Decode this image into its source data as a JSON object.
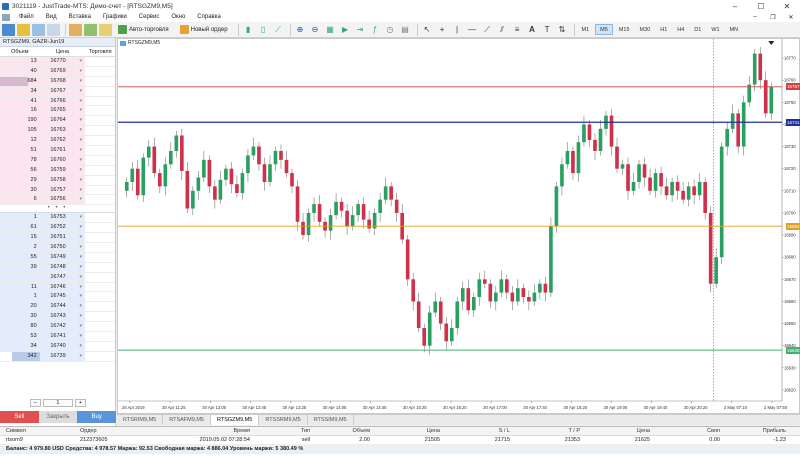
{
  "window": {
    "title": "3021119 - JustTrade-MTS: Демо-счет - [RTSGZM9,M5]",
    "minimize": "–",
    "maximize": "☐",
    "close": "✕"
  },
  "menu": {
    "items": [
      "Файл",
      "Вид",
      "Вставка",
      "Графики",
      "Сервис",
      "Окно",
      "Справка"
    ],
    "right": [
      "–",
      "❐",
      "✕"
    ]
  },
  "toolbar": {
    "autotrade_label": "Авто-торговля",
    "new_order_label": "Новый ордер",
    "timeframes": [
      "M1",
      "M5",
      "M15",
      "M30",
      "H1",
      "H4",
      "D1",
      "W1",
      "MN"
    ],
    "active_timeframe": "M5"
  },
  "dom": {
    "title": "RTSGZM9, GAZR-Jun19",
    "headers": {
      "volume": "Объем",
      "price": "Цена",
      "trade": "Торговля"
    },
    "asks": [
      {
        "volume": "13",
        "price": "16770"
      },
      {
        "volume": "40",
        "price": "16769"
      },
      {
        "volume": "684",
        "price": "16768"
      },
      {
        "volume": "34",
        "price": "16767"
      },
      {
        "volume": "41",
        "price": "16766"
      },
      {
        "volume": "16",
        "price": "16765"
      },
      {
        "volume": "190",
        "price": "16764"
      },
      {
        "volume": "105",
        "price": "16763"
      },
      {
        "volume": "12",
        "price": "16762"
      },
      {
        "volume": "51",
        "price": "16761"
      },
      {
        "volume": "78",
        "price": "16760"
      },
      {
        "volume": "56",
        "price": "16759"
      },
      {
        "volume": "29",
        "price": "16758"
      },
      {
        "volume": "30",
        "price": "16757"
      },
      {
        "volume": "6",
        "price": "16756"
      }
    ],
    "separator": "• • •",
    "bids": [
      {
        "volume": "1",
        "price": "16753"
      },
      {
        "volume": "61",
        "price": "16752"
      },
      {
        "volume": "15",
        "price": "16751"
      },
      {
        "volume": "2",
        "price": "16750"
      },
      {
        "volume": "55",
        "price": "16749"
      },
      {
        "volume": "39",
        "price": "16748"
      },
      {
        "volume": "",
        "price": "16747"
      },
      {
        "volume": "11",
        "price": "16746"
      },
      {
        "volume": "1",
        "price": "16745"
      },
      {
        "volume": "20",
        "price": "16744"
      },
      {
        "volume": "30",
        "price": "16743"
      },
      {
        "volume": "80",
        "price": "16742"
      },
      {
        "volume": "53",
        "price": "16741"
      },
      {
        "volume": "34",
        "price": "16740"
      },
      {
        "volume": "342",
        "price": "16739"
      }
    ],
    "qty_minus": "–",
    "qty_value": "1",
    "qty_plus": "+",
    "sell_label": "Sell",
    "close_label": "Закрыть",
    "buy_label": "Buy"
  },
  "chart": {
    "title": "RTSGZM9,M5",
    "x_labels": [
      "26 Apr 2019",
      "30 Apr 11:25",
      "30 Apr 12:05",
      "30 Apr 12:45",
      "30 Apr 13:25",
      "30 Apr 14:05",
      "30 Apr 14:45",
      "30 Apr 15:25",
      "30 Apr 16:20",
      "30 Apr 17:00",
      "30 Apr 17:40",
      "30 Apr 18:20",
      "30 Apr 19:00",
      "30 Apr 19:40",
      "30 Apr 20:20",
      "2 May 07:10",
      "2 May 07:50"
    ],
    "y_labels": [
      "16770",
      "16760",
      "16750",
      "16740",
      "16730",
      "16720",
      "16710",
      "16700",
      "16690",
      "16680",
      "16670",
      "16660",
      "16650",
      "16640",
      "16630",
      "16620"
    ],
    "line_labels": {
      "red": "16757",
      "blue": "16741",
      "orange": "16694",
      "green": "16638"
    }
  },
  "chart_data": {
    "type": "candlestick",
    "hlines": [
      {
        "name": "red",
        "value": 16757,
        "color": "#d04040"
      },
      {
        "name": "blue",
        "value": 16741,
        "color": "#2030a0"
      },
      {
        "name": "orange",
        "value": 16694,
        "color": "#e0a020"
      },
      {
        "name": "green",
        "value": 16638,
        "color": "#40b070"
      }
    ],
    "vline_after_index": 106,
    "closes": [
      16714,
      16720,
      16708,
      16725,
      16730,
      16718,
      16712,
      16722,
      16728,
      16735,
      16719,
      16702,
      16710,
      16716,
      16724,
      16712,
      16706,
      16715,
      16720,
      16713,
      16709,
      16718,
      16726,
      16730,
      16722,
      16714,
      16722,
      16728,
      16724,
      16718,
      16712,
      16696,
      16690,
      16700,
      16704,
      16696,
      16692,
      16699,
      16705,
      16701,
      16694,
      16699,
      16704,
      16697,
      16693,
      16700,
      16706,
      16712,
      16706,
      16700,
      16688,
      16670,
      16660,
      16648,
      16640,
      16655,
      16660,
      16650,
      16642,
      16648,
      16660,
      16666,
      16656,
      16662,
      16670,
      16668,
      16660,
      16664,
      16670,
      16664,
      16660,
      16666,
      16662,
      16660,
      16664,
      16668,
      16664,
      16694,
      16712,
      16722,
      16728,
      16718,
      16732,
      16740,
      16733,
      16728,
      16738,
      16744,
      16730,
      16720,
      16722,
      16710,
      16714,
      16722,
      16716,
      16710,
      16718,
      16712,
      16708,
      16714,
      16710,
      16706,
      16712,
      16708,
      16714,
      16700,
      16668,
      16680,
      16730,
      16738,
      16745,
      16730,
      16750,
      16758,
      16772,
      16760,
      16745,
      16757
    ]
  },
  "tabs": [
    "RTSRIM9,M5",
    "RTSAFM9,M5",
    "RTSGZM9,M5",
    "RTSSRM9,M5",
    "RTSSIM9,M5"
  ],
  "active_tab": "RTSGZM9,M5",
  "terminal": {
    "headers": [
      "Символ",
      "Ордер",
      "Время",
      "Тип",
      "Объем",
      "Цена",
      "S / L",
      "T / P",
      "Цена",
      "Своп",
      "Прибыль"
    ],
    "row": [
      "rtsom9",
      "212373605",
      "2019.05.02 07:28:54",
      "sell",
      "2.00",
      "21505",
      "21715",
      "21353",
      "21625",
      "0.00",
      "-1.23"
    ],
    "balance": "Баланс: 4 979.80 USD  Средства: 4 978.57  Маржа: 92.53  Свободная маржа: 4 886.04  Уровень маржи: 5 380.49 %"
  },
  "colors": {
    "bull": "#2aa060",
    "bear": "#d0304a"
  }
}
